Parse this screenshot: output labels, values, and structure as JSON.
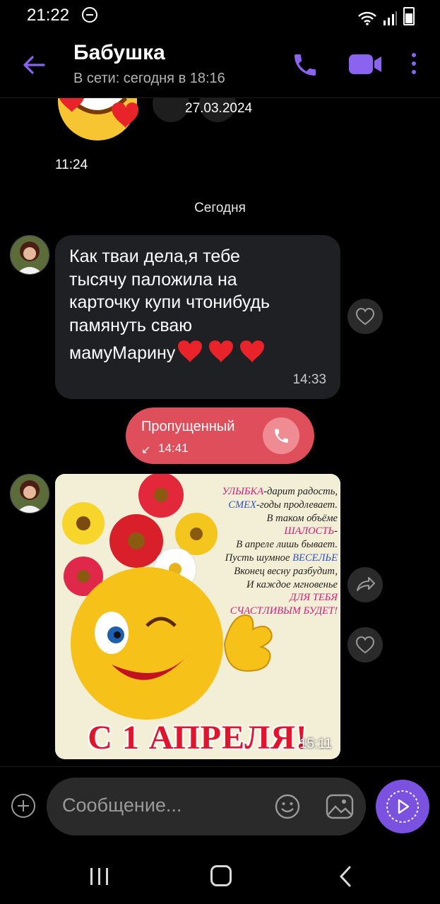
{
  "status_bar": {
    "time": "21:22"
  },
  "header": {
    "contact_name": "Бабушка",
    "contact_status": "В сети: сегодня в 18:16"
  },
  "messages": {
    "sticker": {
      "date": "27.03.2024",
      "time": "11:24"
    },
    "day_separator": "Сегодня",
    "text_message": {
      "lines": [
        "Как тваи дела,я тебе",
        "тысячу паложила на",
        "карточку купи чтонибудь",
        "памянуть сваю",
        "мамуМарину"
      ],
      "emoji": "❤️❤️❤️",
      "time": "14:33"
    },
    "missed_call": {
      "label": "Пропущенный",
      "arrow": "↙",
      "time": "14:41"
    },
    "photo": {
      "poem_lines": [
        [
          "УЛЫБКА",
          "-дарит радость,"
        ],
        [
          "СМЕХ",
          "-годы продлевает."
        ],
        [
          "",
          "В таком объёме"
        ],
        [
          "ШАЛОСТЬ",
          "-"
        ],
        [
          "",
          "В апреле лишь бывает."
        ],
        [
          "Пусть шумное ",
          "ВЕСЕЛЬЕ"
        ],
        [
          "",
          "Вконец весну разбудит,"
        ],
        [
          "",
          "И каждое мгновенье"
        ],
        [
          "ДЛЯ ТЕБЯ",
          ""
        ],
        [
          "СЧАСТЛИВЫМ БУДЕТ!",
          ""
        ]
      ],
      "greeting": "С 1 АПРЕЛЯ!",
      "time": "15:11"
    }
  },
  "input": {
    "placeholder": "Сообщение..."
  },
  "colors": {
    "accent": "#7b52e0",
    "missed_call": "#de4e5b",
    "bubble": "#1e2024",
    "background": "#000000"
  }
}
